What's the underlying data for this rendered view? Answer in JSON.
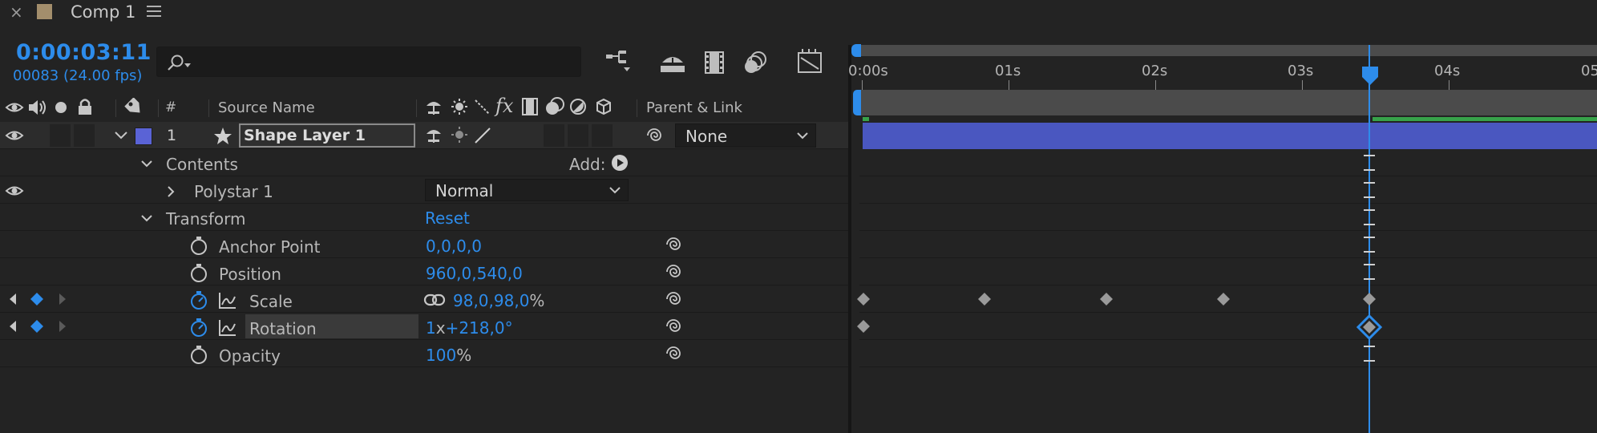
{
  "tab": {
    "close": "×",
    "title": "Comp 1"
  },
  "header": {
    "timecode": "0:00:03:11",
    "frame_info": "00083 (24.00 fps)",
    "search_placeholder": ""
  },
  "columns": {
    "number": "#",
    "source_name": "Source Name",
    "parent_link": "Parent & Link"
  },
  "layer": {
    "index": "1",
    "name": "Shape Layer 1",
    "label_color": "#5a63d6",
    "parent": "None"
  },
  "properties": {
    "contents_label": "Contents",
    "add_label": "Add:",
    "polystar_label": "Polystar 1",
    "blend_mode": "Normal",
    "transform_label": "Transform",
    "reset_label": "Reset",
    "anchor_point_label": "Anchor Point",
    "anchor_point_value": "0,0,0,0",
    "position_label": "Position",
    "position_value": "960,0,540,0",
    "scale_label": "Scale",
    "scale_value": "98,0,98,0",
    "scale_unit": "%",
    "rotation_label": "Rotation",
    "rotation_revs": "1",
    "rotation_x": "x",
    "rotation_value": "+218,0°",
    "opacity_label": "Opacity",
    "opacity_value": "100",
    "opacity_unit": "%"
  },
  "ruler": {
    "labels": [
      "0:00s",
      "01s",
      "02s",
      "03s",
      "04s",
      "05"
    ]
  },
  "colors": {
    "accent": "#2d8ceb",
    "layer_bar": "#4a57c0",
    "work_area": "#4b4b4b",
    "in_out_green": "#37a24a"
  }
}
